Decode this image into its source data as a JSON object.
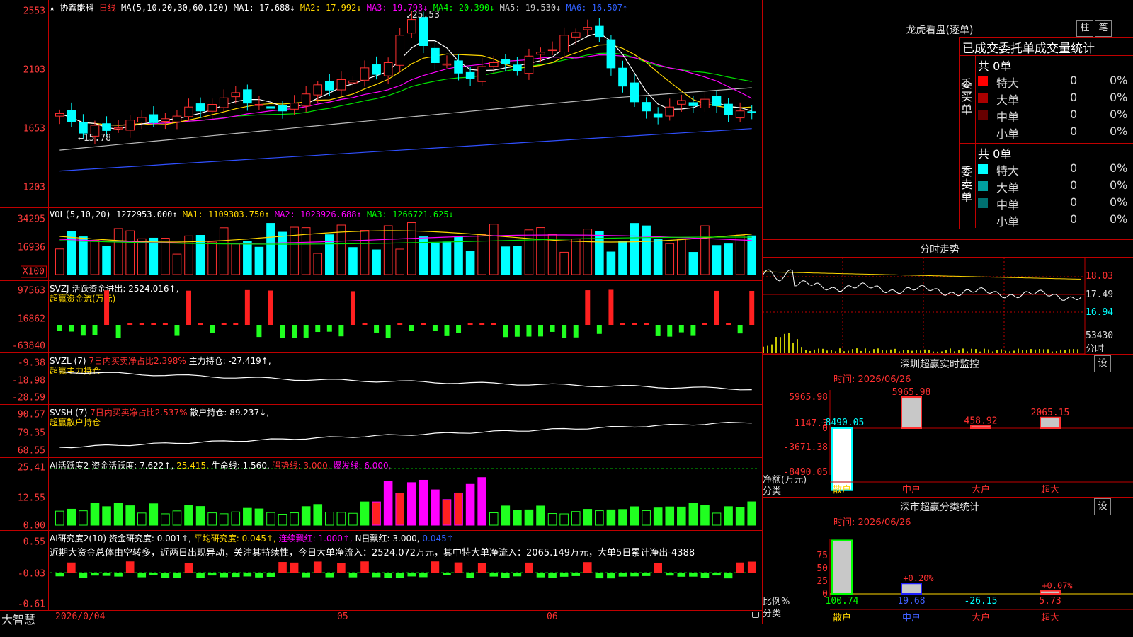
{
  "stock": {
    "star": "★",
    "name": "协鑫能科",
    "period": "日线"
  },
  "ma_header": {
    "label": "MA(5,10,20,30,60,120)",
    "items": [
      {
        "text": "MA1: 17.688↓",
        "color": "#ffffff"
      },
      {
        "text": "MA2: 17.992↓",
        "color": "#ffd700"
      },
      {
        "text": "MA3: 19.793↓",
        "color": "#ff00ff"
      },
      {
        "text": "MA4: 20.390↓",
        "color": "#00ff00"
      },
      {
        "text": "MA5: 19.530↓",
        "color": "#c8c8c8"
      },
      {
        "text": "MA6: 16.507↑",
        "color": "#3060ff"
      }
    ]
  },
  "price_axis": [
    "2553",
    "2103",
    "1653",
    "1203"
  ],
  "price_marks": {
    "high": "25.53",
    "low": "15.78"
  },
  "vol": {
    "axis": [
      "34295",
      "16936",
      "X100"
    ],
    "header": "VOL(5,10,20)",
    "items": [
      {
        "text": "1272953.000↑",
        "color": "#ffffff"
      },
      {
        "text": "MA1: 1109303.750↑",
        "color": "#ffd700"
      },
      {
        "text": "MA2: 1023926.688↑",
        "color": "#ff00ff"
      },
      {
        "text": "MA3: 1266721.625↓",
        "color": "#00ff00"
      }
    ]
  },
  "svzj": {
    "axis": [
      "97563",
      "16862",
      "-63840"
    ],
    "header": "SVZJ  活跃资金进出: 2524.016↑,",
    "sub": "超赢资金流(万元)"
  },
  "svzl": {
    "axis": [
      "-9.38",
      "-18.98",
      "-28.59"
    ],
    "header_a": "SVZL (7)",
    "header_b": "7日内买卖净占比2.398%",
    "header_c": "主力持仓: -27.419↑,",
    "sub": "超赢主力持仓"
  },
  "svsh": {
    "axis": [
      "90.57",
      "79.35",
      "68.55"
    ],
    "header_a": "SVSH (7)",
    "header_b": "7日内买卖净占比2.537%",
    "header_c": "散户持仓: 89.237↓,",
    "sub": "超赢散户持仓"
  },
  "ai_active": {
    "axis": [
      "25.41",
      "12.55",
      "0.00"
    ],
    "items": [
      {
        "text": "AI活跃度2",
        "color": "#ffffff"
      },
      {
        "text": "资金活跃度: 7.622↑,",
        "color": "#ffffff"
      },
      {
        "text": "25.415,",
        "color": "#ffd700"
      },
      {
        "text": "生命线: 1.560,",
        "color": "#ffffff"
      },
      {
        "text": "强势线: 3.000,",
        "color": "#ff3030"
      },
      {
        "text": "爆发线: 6.000,",
        "color": "#ff00ff"
      }
    ]
  },
  "ai_research": {
    "axis": [
      "0.55",
      "-0.03",
      "-0.61"
    ],
    "items": [
      {
        "text": "AI研究度2(10)",
        "color": "#ffffff"
      },
      {
        "text": "资金研究度: 0.001↑,",
        "color": "#ffffff"
      },
      {
        "text": "平均研究度: 0.045↑,",
        "color": "#ffd700"
      },
      {
        "text": "连续飘红: 1.000↑,",
        "color": "#ff00ff"
      },
      {
        "text": "N日飘红: 3.000,",
        "color": "#ffffff"
      },
      {
        "text": "0.045↑",
        "color": "#3060ff"
      }
    ],
    "note": "近期大资金总体由空转多，近两日出现异动，关注其持续性，今日大单净流入：2524.072万元，其中特大单净流入：2065.149万元，大单5日累计净出-4388"
  },
  "bottom": {
    "logo": "大智慧",
    "dates": [
      "2026/0/04",
      "05",
      "06"
    ]
  },
  "lhb": {
    "title": "龙虎看盘(逐单)",
    "btn_a": "柱",
    "btn_b": "笔",
    "subtitle": "已成交委托单成交量统计",
    "buy_label": "委买单",
    "sell_label": "委卖单",
    "buy_total": "共 0单",
    "sell_total": "共 0单",
    "buy_rows": [
      {
        "label": "特大",
        "val": "0",
        "pct": "0%",
        "color": "#ff0000"
      },
      {
        "label": "大单",
        "val": "0",
        "pct": "0%",
        "color": "#aa0000"
      },
      {
        "label": "中单",
        "val": "0",
        "pct": "0%",
        "color": "#660000"
      },
      {
        "label": "小单",
        "val": "0",
        "pct": "0%",
        "color": ""
      }
    ],
    "sell_rows": [
      {
        "label": "特大",
        "val": "0",
        "pct": "0%",
        "color": "#00ffff"
      },
      {
        "label": "大单",
        "val": "0",
        "pct": "0%",
        "color": "#00a0a0"
      },
      {
        "label": "中单",
        "val": "0",
        "pct": "0%",
        "color": "#007070"
      },
      {
        "label": "小单",
        "val": "0",
        "pct": "0%",
        "color": ""
      }
    ]
  },
  "intraday": {
    "title": "分时走势",
    "axis": [
      "18.03",
      "17.49",
      "16.94",
      "53430"
    ],
    "axis_unit": "分时"
  },
  "sz_monitor": {
    "title": "深圳超赢实时监控",
    "btn": "设",
    "time": "时间: 2026/06/26",
    "axis": [
      "5965.98",
      "1147.3",
      "0",
      "-3671.38",
      "-8490.05"
    ],
    "unit": "净额(万元)",
    "cat_label": "分类",
    "bars": [
      {
        "cat": "散户",
        "val": "-8490.05"
      },
      {
        "cat": "中户",
        "val": "5965.98"
      },
      {
        "cat": "大户",
        "val": "458.92"
      },
      {
        "cat": "超大",
        "val": "2065.15"
      }
    ]
  },
  "sz_class": {
    "title": "深市超赢分类统计",
    "btn": "设",
    "time": "时间: 2026/06/26",
    "axis": [
      "75",
      "50",
      "25",
      "0"
    ],
    "unit": "比例%",
    "cat_label": "分类",
    "bars": [
      {
        "cat": "散户",
        "val": "100.74",
        "pct": ""
      },
      {
        "cat": "中户",
        "val": "19.68",
        "pct": "+0.20%"
      },
      {
        "cat": "大户",
        "val": "-26.15",
        "pct": ""
      },
      {
        "cat": "超大",
        "val": "5.73",
        "pct": "+0.07%"
      }
    ]
  },
  "chart_data": {
    "type": "candlestick",
    "title": "协鑫能科 日线",
    "ylim": [
      12.03,
      25.53
    ],
    "closes": [
      17.7,
      17.1,
      16.2,
      16.8,
      16.4,
      16.6,
      17.2,
      17.4,
      17.0,
      17.3,
      17.5,
      18.2,
      17.9,
      18.4,
      18.9,
      19.3,
      18.5,
      18.4,
      18.1,
      17.9,
      18.5,
      19.2,
      19.9,
      19.5,
      20.3,
      20.2,
      21.2,
      20.7,
      21.6,
      23.7,
      24.9,
      22.9,
      21.6,
      21.5,
      20.8,
      20.4,
      21.3,
      21.6,
      21.5,
      21.0,
      22.1,
      22.4,
      22.6,
      23.7,
      23.9,
      24.3,
      23.6,
      21.2,
      19.8,
      18.6,
      17.9,
      17.4,
      18.2,
      18.7,
      18.3,
      18.8,
      18.3,
      17.6,
      17.9,
      17.8
    ]
  }
}
